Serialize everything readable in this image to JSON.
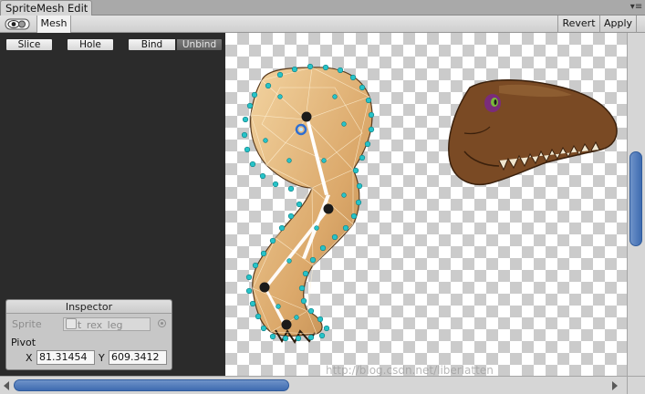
{
  "window": {
    "title": "SpriteMesh Edit",
    "menu_icon": "▾≡"
  },
  "toolbar": {
    "visibility_toggle": "eye-icon",
    "mesh_tab": "Mesh",
    "revert": "Revert",
    "apply": "Apply"
  },
  "tools": {
    "slice": "Slice",
    "hole": "Hole",
    "bind": "Bind",
    "unbind": "Unbind"
  },
  "inspector": {
    "title": "Inspector",
    "sprite_label": "Sprite",
    "sprite_value": "t_rex_leg",
    "pivot_label": "Pivot",
    "x_label": "X",
    "x_value": "81.31454",
    "y_label": "Y",
    "y_value": "609.3412"
  },
  "watermark": "http://blog.csdn.net/liberlatten",
  "colors": {
    "panel_dark": "#2b2b2b",
    "mesh_vertex": "#27c3c8",
    "bone": "#ffffff",
    "joint": "#1a1a1a",
    "pivot": "#2f6fd0",
    "scroll_thumb": "#4a78bd"
  }
}
